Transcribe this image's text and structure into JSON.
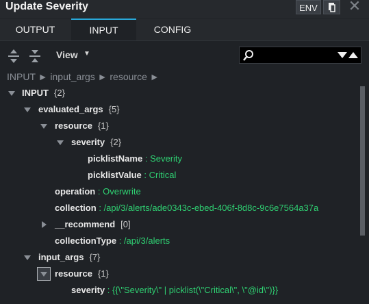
{
  "window": {
    "title": "Update Severity",
    "env_label": "ENV"
  },
  "tabs": [
    {
      "label": "OUTPUT",
      "active": false
    },
    {
      "label": "INPUT",
      "active": true
    },
    {
      "label": "CONFIG",
      "active": false
    }
  ],
  "toolbar": {
    "view_label": "View",
    "search_value": ""
  },
  "breadcrumb": "INPUT ► input_args ► resource ►",
  "tree": {
    "root": {
      "key": "INPUT",
      "count": "{2}"
    },
    "evaluated_args": {
      "key": "evaluated_args",
      "count": "{5}"
    },
    "resource_1": {
      "key": "resource",
      "count": "{1}"
    },
    "severity_group": {
      "key": "severity",
      "count": "{2}"
    },
    "picklist_name": {
      "key": "picklistName",
      "value": "Severity"
    },
    "picklist_value": {
      "key": "picklistValue",
      "value": "Critical"
    },
    "operation": {
      "key": "operation",
      "value": "Overwrite"
    },
    "collection": {
      "key": "collection",
      "value": "/api/3/alerts/ade0343c-ebed-406f-8d8c-9c6e7564a37a"
    },
    "recommend": {
      "key": "__recommend",
      "count": "[0]"
    },
    "collection_type": {
      "key": "collectionType",
      "value": "/api/3/alerts"
    },
    "input_args": {
      "key": "input_args",
      "count": "{7}"
    },
    "resource_2": {
      "key": "resource",
      "count": "{1}"
    },
    "severity_expr": {
      "key": "severity",
      "value": "{{\\\"Severity\\\" | picklist(\\\"Critical\\\", \\\"@id\\\")}}"
    },
    "separator": ":"
  },
  "colors": {
    "accent": "#2aa8d8",
    "value_green": "#2fd072",
    "background": "#1f2226"
  }
}
